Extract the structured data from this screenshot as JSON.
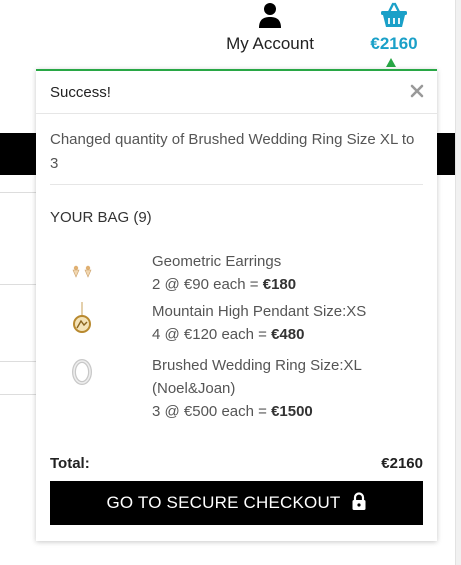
{
  "header": {
    "account_label": "My Account",
    "cart_total": "€2160",
    "accent_color": "#1aa0c8"
  },
  "popup": {
    "title": "Success!",
    "close_glyph": "✕",
    "message": "Changed quantity of Brushed Wedding Ring Size XL to 3",
    "bag_title": "YOUR BAG (9)",
    "items": [
      {
        "name": "Geometric Earrings",
        "qty_text": "2 @ €90 each = ",
        "line_total": "€180",
        "icon": "earrings-icon"
      },
      {
        "name": "Mountain High Pendant Size:XS",
        "qty_text": "4 @ €120 each = ",
        "line_total": "€480",
        "icon": "pendant-icon"
      },
      {
        "name": "Brushed Wedding Ring Size:XL (Noel&Joan)",
        "qty_text": "3 @ €500 each = ",
        "line_total": "€1500",
        "icon": "ring-icon"
      }
    ],
    "total_label": "Total:",
    "total_value": "€2160",
    "checkout_label": "GO TO SECURE CHECKOUT",
    "success_color": "#28a745"
  }
}
